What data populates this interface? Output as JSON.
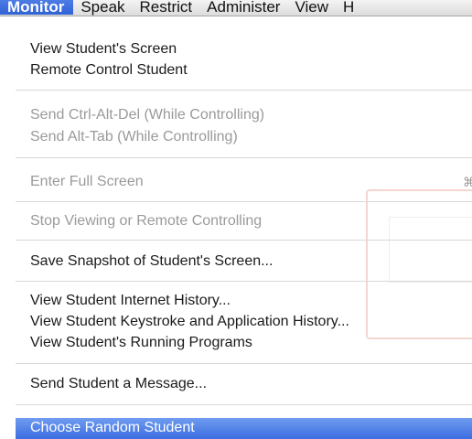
{
  "menubar": {
    "items": [
      "Monitor",
      "Speak",
      "Restrict",
      "Administer",
      "View",
      "H"
    ],
    "active_index": 0,
    "accent_color": "#3a6ad9"
  },
  "menu": {
    "items": {
      "view_screen": "View Student's Screen",
      "remote_control": "Remote Control Student",
      "send_ctrl_alt_del": "Send Ctrl-Alt-Del (While Controlling)",
      "send_alt_tab": "Send Alt-Tab (While Controlling)",
      "enter_full_screen": "Enter Full Screen",
      "stop_viewing": "Stop Viewing or Remote Controlling",
      "save_snapshot": "Save Snapshot of Student's Screen...",
      "internet_history": "View Student Internet History...",
      "keystroke_history": "View Student Keystroke and Application History...",
      "running_programs": "View Student's Running Programs",
      "send_message": "Send Student a Message...",
      "choose_random": "Choose Random Student"
    },
    "full_screen_shortcut": "⌘",
    "highlight_color": "#4a7ae4"
  }
}
